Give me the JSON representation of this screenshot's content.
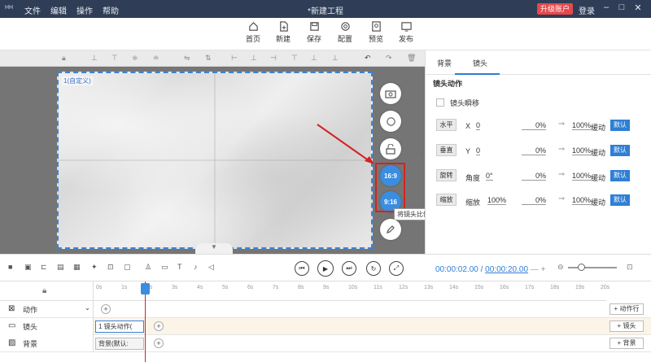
{
  "titlebar": {
    "logo": "HH",
    "menu": [
      "文件",
      "编辑",
      "操作",
      "帮助"
    ],
    "doc_title": "*新建工程",
    "upgrade": "升级账户",
    "login": "登录",
    "win_min": "–",
    "win_max": "□",
    "win_close": "✕"
  },
  "toolbar": {
    "home": "首页",
    "new": "新建",
    "save": "保存",
    "config": "配置",
    "preview": "预览",
    "publish": "发布"
  },
  "stage": {
    "camera_tag": "1(自定义)",
    "ratio_16_9": "16:9",
    "ratio_9_16": "9:16",
    "tooltip": "将镜头比例设置为9:16",
    "collapse_arrow": "▶",
    "bottom_tab": "▼"
  },
  "right_panel": {
    "tabs": [
      "背景",
      "镜头"
    ],
    "active_tab": "镜头",
    "section_title": "镜头动作",
    "instant_move": "镜头瞬移",
    "rows": [
      {
        "button": "水平",
        "axis": "X",
        "value": "0",
        "from": "0%",
        "to": "100%",
        "ease": "缓动",
        "default": "默认"
      },
      {
        "button": "垂直",
        "axis": "Y",
        "value": "0",
        "from": "0%",
        "to": "100%",
        "ease": "缓动",
        "default": "默认"
      },
      {
        "button": "旋转",
        "axis": "角度",
        "value": "0°",
        "from": "0%",
        "to": "100%",
        "ease": "缓动",
        "default": "默认"
      },
      {
        "button": "缩放",
        "axis": "缩放",
        "value": "100%",
        "from": "0%",
        "to": "100%",
        "ease": "缓动",
        "default": "默认"
      }
    ]
  },
  "controls": {
    "current_time": "00:00:02.00",
    "separator": "/",
    "total_time": "00:00:20.00",
    "minus": "—",
    "plus": "+"
  },
  "timeline": {
    "ticks": [
      "0s",
      "1s",
      "2s",
      "3s",
      "4s",
      "5s",
      "6s",
      "7s",
      "8s",
      "9s",
      "10s",
      "11s",
      "12s",
      "13s",
      "14s",
      "15s",
      "16s",
      "17s",
      "18s",
      "19s",
      "20s"
    ],
    "tracks": [
      {
        "label": "动作",
        "clip": "",
        "add": "+ 动作行"
      },
      {
        "label": "镜头",
        "clip": "1 镜头动作(",
        "add": "+ 镜头"
      },
      {
        "label": "背景",
        "clip": "背景(默认:",
        "add": "+ 背景"
      }
    ]
  },
  "colors": {
    "accent": "#2f7fd4",
    "titlebar": "#2f3d56",
    "highlight": "#d12424",
    "upgrade": "#e5484d"
  }
}
